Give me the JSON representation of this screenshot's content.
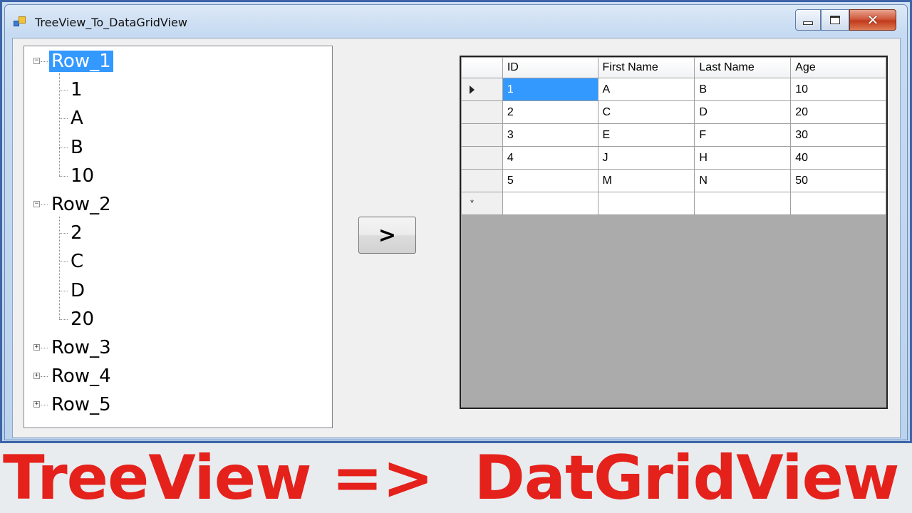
{
  "window": {
    "title": "TreeView_To_DataGridView",
    "close_glyph": "✕"
  },
  "tree": {
    "nodes": [
      {
        "label": "Row_1",
        "expanded": true,
        "selected": true,
        "children": [
          "1",
          "A",
          "B",
          "10"
        ]
      },
      {
        "label": "Row_2",
        "expanded": true,
        "selected": false,
        "children": [
          "2",
          "C",
          "D",
          "20"
        ]
      },
      {
        "label": "Row_3",
        "expanded": false
      },
      {
        "label": "Row_4",
        "expanded": false
      },
      {
        "label": "Row_5",
        "expanded": false
      }
    ],
    "expanded_glyph": "−",
    "collapsed_glyph": "+"
  },
  "transfer_button": {
    "label": ">"
  },
  "grid": {
    "columns": [
      "ID",
      "First Name",
      "Last Name",
      "Age"
    ],
    "rows": [
      [
        "1",
        "A",
        "B",
        "10"
      ],
      [
        "2",
        "C",
        "D",
        "20"
      ],
      [
        "3",
        "E",
        "F",
        "30"
      ],
      [
        "4",
        "J",
        "H",
        "40"
      ],
      [
        "5",
        "M",
        "N",
        "50"
      ]
    ],
    "new_row_marker": "*",
    "selected_cell": {
      "row": 0,
      "col": 0
    },
    "selected_color": "#3399ff"
  },
  "banner": {
    "text": "TreeView =>  DatGridView",
    "color": "#e5211b"
  }
}
